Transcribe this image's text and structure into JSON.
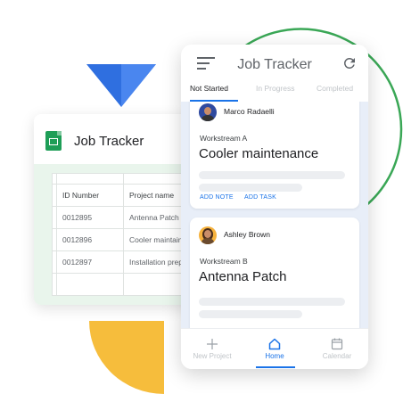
{
  "colors": {
    "accent": "#1a73e8",
    "sheets_green": "#1e9e57",
    "triangle_blue": "#2f6fe0",
    "arc_green": "#3aa756",
    "quarter_yellow": "#f6bd3c"
  },
  "sheet": {
    "icon": "sheets-icon",
    "title": "Job Tracker",
    "columns": [
      "ID Number",
      "Project name"
    ],
    "rows": [
      [
        "0012895",
        "Antenna Patch"
      ],
      [
        "0012896",
        "Cooler maintainance"
      ],
      [
        "0012897",
        "Installation preparation"
      ]
    ]
  },
  "app": {
    "title": "Job Tracker",
    "menu_icon": "menu-icon",
    "refresh_icon": "refresh-icon",
    "tabs": [
      "Not Started",
      "In Progress",
      "Completed"
    ],
    "active_tab": "Not Started",
    "cards": [
      {
        "name": "Marco Radaelli",
        "workstream": "Workstream A",
        "title": "Cooler maintenance",
        "actions": [
          "ADD NOTE",
          "ADD TASK"
        ]
      },
      {
        "name": "Ashley Brown",
        "workstream": "Workstream B",
        "title": "Antenna Patch"
      }
    ],
    "nav": [
      {
        "label": "New Project",
        "icon": "plus-icon"
      },
      {
        "label": "Home",
        "icon": "home-icon"
      },
      {
        "label": "Calendar",
        "icon": "calendar-icon"
      }
    ],
    "active_nav": "Home"
  }
}
